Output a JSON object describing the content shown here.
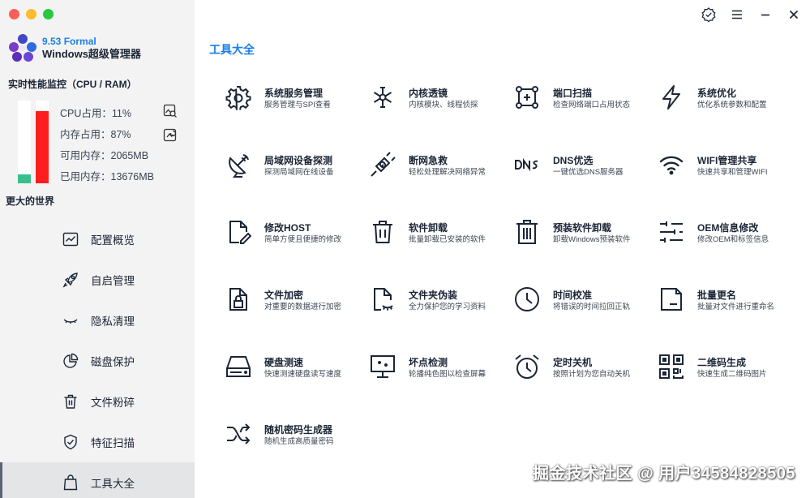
{
  "app": {
    "version": "9.53 Formal",
    "name": "Windows超级管理器"
  },
  "monitor": {
    "title": "实时性能监控（CPU / RAM）",
    "cpu_fraction": 0.11,
    "ram_fraction": 0.87,
    "stats": [
      "CPU占用：11%",
      "内存占用：87%",
      "可用内存：2065MB",
      "已用内存：13676MB"
    ],
    "tagline": "更大的世界",
    "colors": {
      "cpu": "#39c08a",
      "ram": "#ff1d1d"
    }
  },
  "nav": {
    "items": [
      {
        "label": "配置概览",
        "icon": "chart-icon"
      },
      {
        "label": "自启管理",
        "icon": "rocket-icon"
      },
      {
        "label": "隐私清理",
        "icon": "eye-closed-icon"
      },
      {
        "label": "磁盘保护",
        "icon": "pie-icon"
      },
      {
        "label": "文件粉碎",
        "icon": "trash-icon"
      },
      {
        "label": "特征扫描",
        "icon": "shield-icon"
      },
      {
        "label": "工具大全",
        "icon": "bag-icon"
      }
    ],
    "active": "工具大全"
  },
  "section_title": "工具大全",
  "tools": [
    {
      "title": "系统服务管理",
      "subtitle": "服务管理与SPI查看",
      "icon": "gear-icon"
    },
    {
      "title": "内核透镜",
      "subtitle": "内核模块、线程侦探",
      "icon": "molecule-icon"
    },
    {
      "title": "端口扫描",
      "subtitle": "检查网络端口占用状态",
      "icon": "port-icon"
    },
    {
      "title": "系统优化",
      "subtitle": "优化系统参数和配置",
      "icon": "bolt-icon"
    },
    {
      "title": "局域网设备探测",
      "subtitle": "探测局域网在线设备",
      "icon": "radar-icon"
    },
    {
      "title": "断网急救",
      "subtitle": "轻松处理解决网络异常",
      "icon": "plug-icon"
    },
    {
      "title": "DNS优选",
      "subtitle": "一键优选DNS服务器",
      "icon": "dns-icon"
    },
    {
      "title": "WIFI管理共享",
      "subtitle": "快速共享和管理WIFI",
      "icon": "wifi-icon"
    },
    {
      "title": "修改HOST",
      "subtitle": "简单方便且便捷的修改",
      "icon": "edit-file-icon"
    },
    {
      "title": "软件卸载",
      "subtitle": "批量卸载已安装的软件",
      "icon": "trash-icon"
    },
    {
      "title": "预装软件卸载",
      "subtitle": "卸载Windows预装软件",
      "icon": "trash-bin-icon"
    },
    {
      "title": "OEM信息修改",
      "subtitle": "修改OEM和标签信息",
      "icon": "sliders-icon"
    },
    {
      "title": "文件加密",
      "subtitle": "对重要的数据进行加密",
      "icon": "lock-file-icon"
    },
    {
      "title": "文件夹伪装",
      "subtitle": "全力保护您的学习资料",
      "icon": "hidden-file-icon"
    },
    {
      "title": "时间校准",
      "subtitle": "将错误的时间拉回正轨",
      "icon": "clock-icon"
    },
    {
      "title": "批量更名",
      "subtitle": "批量对文件进行重命名",
      "icon": "rename-icon"
    },
    {
      "title": "硬盘测速",
      "subtitle": "快速测速硬盘读写速度",
      "icon": "disk-icon"
    },
    {
      "title": "坏点检测",
      "subtitle": "轮播纯色图以检查屏幕",
      "icon": "monitor-icon"
    },
    {
      "title": "定时关机",
      "subtitle": "按照计划为您自动关机",
      "icon": "alarm-icon"
    },
    {
      "title": "二维码生成",
      "subtitle": "快速生成二维码图片",
      "icon": "qrcode-icon"
    },
    {
      "title": "随机密码生成器",
      "subtitle": "随机生成高质量密码",
      "icon": "shuffle-icon"
    }
  ],
  "watermark": "掘金技术社区 @ 用户3458482850​5"
}
